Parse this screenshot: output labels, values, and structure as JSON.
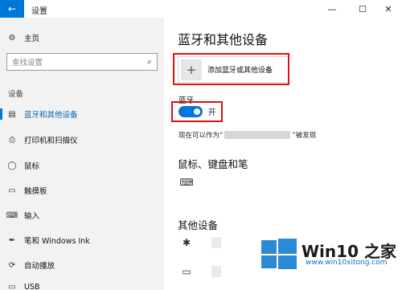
{
  "window": {
    "back_icon": "back-arrow-icon",
    "title": "设置",
    "controls": {
      "minimize": "—",
      "maximize": "☐",
      "close": "✕"
    }
  },
  "sidebar": {
    "home": {
      "icon": "gear-icon",
      "glyph": "⚙",
      "label": "主页"
    },
    "search": {
      "placeholder": "查找设置",
      "icon": "search-icon"
    },
    "section_label": "设备",
    "items": [
      {
        "icon": "bluetooth-devices-icon",
        "glyph": "▤",
        "label": "蓝牙和其他设备",
        "active": true
      },
      {
        "icon": "printer-icon",
        "glyph": "⎙",
        "label": "打印机和扫描仪",
        "active": false
      },
      {
        "icon": "mouse-icon",
        "glyph": "◯",
        "label": "鼠标",
        "active": false
      },
      {
        "icon": "touchpad-icon",
        "glyph": "▭",
        "label": "触摸板",
        "active": false
      },
      {
        "icon": "keyboard-icon",
        "glyph": "⌨",
        "label": "输入",
        "active": false
      },
      {
        "icon": "pen-icon",
        "glyph": "✒",
        "label": "笔和 Windows Ink",
        "active": false
      },
      {
        "icon": "autoplay-icon",
        "glyph": "⟳",
        "label": "自动播放",
        "active": false
      },
      {
        "icon": "usb-icon",
        "glyph": "▭",
        "label": "USB",
        "active": false
      }
    ]
  },
  "main": {
    "title": "蓝牙和其他设备",
    "add_device": {
      "icon": "plus-icon",
      "glyph": "+",
      "label": "添加蓝牙或其他设备"
    },
    "bluetooth": {
      "label": "蓝牙",
      "toggle_state": "on",
      "toggle_text": "开",
      "discoverable_prefix": "现在可以作为“",
      "discoverable_suffix": "”被发现"
    },
    "mouse_section": {
      "title": "鼠标、键盘和笔",
      "device_icon": "keyboard-icon",
      "glyph": "⌨"
    },
    "other_section": {
      "title": "其他设备",
      "devices": [
        {
          "icon": "bluetooth-icon",
          "glyph": "✱"
        },
        {
          "icon": "device-icon",
          "glyph": "▭"
        }
      ]
    }
  },
  "watermark": {
    "logo_icon": "windows-logo-icon",
    "brand": "Win10 之家",
    "url": "www.win10xitong.com",
    "color": "#2b8ad6"
  },
  "colors": {
    "accent": "#0078d7",
    "highlight_border": "#e01010",
    "sidebar_bg": "#f2f2f2"
  }
}
